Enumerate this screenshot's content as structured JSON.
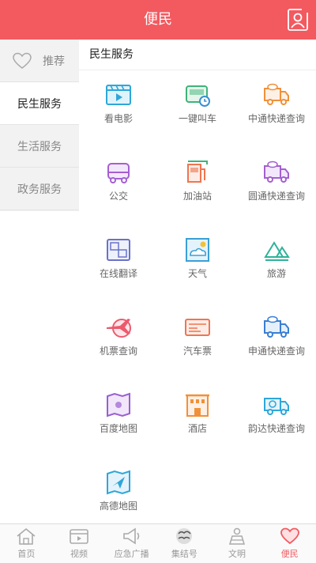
{
  "header": {
    "title": "便民"
  },
  "sidebar": {
    "items": [
      {
        "label": "推荐"
      },
      {
        "label": "民生服务"
      },
      {
        "label": "生活服务"
      },
      {
        "label": "政务服务"
      }
    ]
  },
  "main": {
    "section_title": "民生服务",
    "services": [
      {
        "label": "看电影",
        "icon": "movie-icon"
      },
      {
        "label": "一键叫车",
        "icon": "taxi-icon"
      },
      {
        "label": "中通快递查询",
        "icon": "delivery-truck-icon"
      },
      {
        "label": "公交",
        "icon": "bus-icon"
      },
      {
        "label": "加油站",
        "icon": "gas-station-icon"
      },
      {
        "label": "圆通快递查询",
        "icon": "delivery-truck-icon"
      },
      {
        "label": "在线翻译",
        "icon": "translate-icon"
      },
      {
        "label": "天气",
        "icon": "weather-icon"
      },
      {
        "label": "旅游",
        "icon": "travel-icon"
      },
      {
        "label": "机票查询",
        "icon": "airplane-icon"
      },
      {
        "label": "汽车票",
        "icon": "ticket-icon"
      },
      {
        "label": "申通快递查询",
        "icon": "delivery-truck-icon"
      },
      {
        "label": "百度地图",
        "icon": "map-icon"
      },
      {
        "label": "酒店",
        "icon": "hotel-icon"
      },
      {
        "label": "韵达快递查询",
        "icon": "delivery-truck-icon"
      },
      {
        "label": "高德地图",
        "icon": "map-icon"
      }
    ]
  },
  "tabbar": {
    "items": [
      {
        "label": "首页"
      },
      {
        "label": "视频"
      },
      {
        "label": "应急广播"
      },
      {
        "label": "集结号"
      },
      {
        "label": "文明"
      },
      {
        "label": "便民"
      }
    ]
  },
  "colors": {
    "accent": "#f25a60",
    "sidebar_bg": "#f2f2f2"
  }
}
